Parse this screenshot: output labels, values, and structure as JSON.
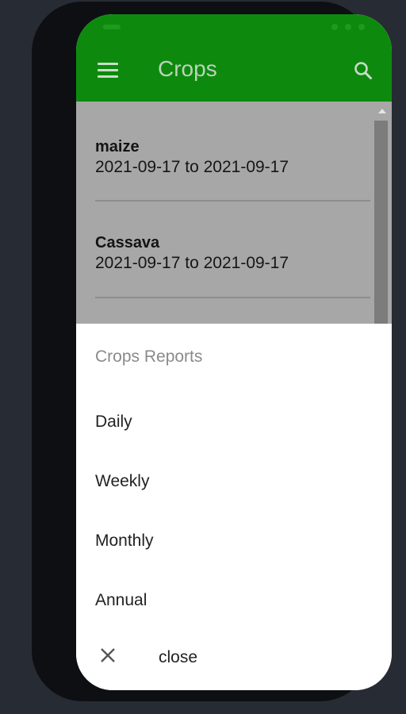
{
  "appbar": {
    "title": "Crops"
  },
  "crops": [
    {
      "name": "maize",
      "range": "2021-09-17 to 2021-09-17"
    },
    {
      "name": "Cassava",
      "range": "2021-09-17 to 2021-09-17"
    }
  ],
  "sheet": {
    "title": "Crops Reports",
    "options": [
      "Daily",
      "Weekly",
      "Monthly",
      "Annual"
    ],
    "close_label": "close"
  },
  "colors": {
    "appbar": "#0d8a0d",
    "background": "#272b33"
  },
  "icons": {
    "menu": "hamburger-menu-icon",
    "search": "search-icon",
    "close": "close-icon"
  }
}
